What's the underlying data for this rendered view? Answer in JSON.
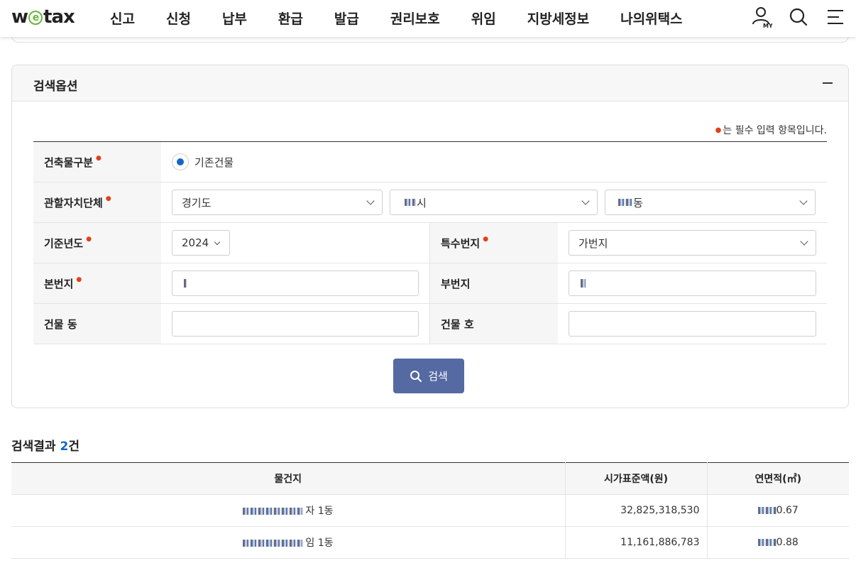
{
  "header": {
    "logo_pre": "w",
    "logo_e": "e",
    "logo_post": "tax",
    "menu": [
      "신고",
      "신청",
      "납부",
      "환급",
      "발급",
      "권리보호",
      "위임",
      "지방세정보",
      "나의위택스"
    ],
    "icons": [
      "user-my-icon",
      "search-icon",
      "menu-icon"
    ]
  },
  "search_panel": {
    "title": "검색옵션",
    "required_note": "는 필수 입력 항목입니다.",
    "building_type": {
      "label": "건축물구분",
      "option": "기존건물"
    },
    "jurisdiction": {
      "label": "관할자치단체",
      "province": "경기도",
      "city_suffix": "시",
      "dong_suffix": "동"
    },
    "base_year": {
      "label": "기준년도",
      "value": "2024"
    },
    "special_lot": {
      "label": "특수번지",
      "value": "가번지"
    },
    "main_lot": {
      "label": "본번지"
    },
    "sub_lot": {
      "label": "부번지"
    },
    "building_dong": {
      "label": "건물 동"
    },
    "building_ho": {
      "label": "건물 호"
    },
    "search_button": "검색"
  },
  "results": {
    "title": "검색결과",
    "count": "2",
    "count_unit": "건",
    "columns": [
      "물건지",
      "시가표준액(원)",
      "연면적(㎡)"
    ],
    "rows": [
      {
        "addr_tail": "자 1동",
        "price": "32,825,318,530",
        "area_tail": "0.67"
      },
      {
        "addr_tail": "임 1동",
        "price": "11,161,886,783",
        "area_tail": "0.88"
      }
    ]
  },
  "colors": {
    "accent": "#1466c6",
    "button": "#556aa3",
    "required": "#e0401a",
    "logo_green": "#6cb33f"
  }
}
